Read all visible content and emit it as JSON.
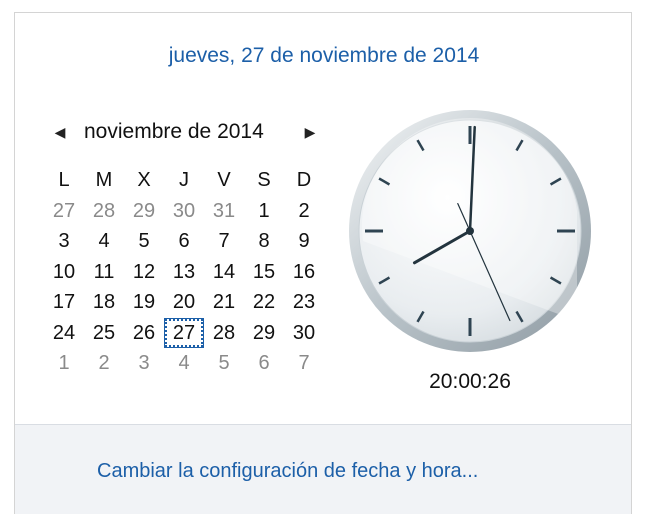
{
  "header": {
    "date_long": "jueves, 27 de noviembre de 2014"
  },
  "calendar": {
    "prev_arrow": "◀",
    "next_arrow": "▶",
    "month_label": "noviembre de 2014",
    "weekdays": [
      "L",
      "M",
      "X",
      "J",
      "V",
      "S",
      "D"
    ],
    "weeks": [
      [
        {
          "d": "27",
          "o": true
        },
        {
          "d": "28",
          "o": true
        },
        {
          "d": "29",
          "o": true
        },
        {
          "d": "30",
          "o": true
        },
        {
          "d": "31",
          "o": true
        },
        {
          "d": "1"
        },
        {
          "d": "2"
        }
      ],
      [
        {
          "d": "3"
        },
        {
          "d": "4"
        },
        {
          "d": "5"
        },
        {
          "d": "6"
        },
        {
          "d": "7"
        },
        {
          "d": "8"
        },
        {
          "d": "9"
        }
      ],
      [
        {
          "d": "10"
        },
        {
          "d": "11"
        },
        {
          "d": "12"
        },
        {
          "d": "13"
        },
        {
          "d": "14"
        },
        {
          "d": "15"
        },
        {
          "d": "16"
        }
      ],
      [
        {
          "d": "17"
        },
        {
          "d": "18"
        },
        {
          "d": "19"
        },
        {
          "d": "20"
        },
        {
          "d": "21"
        },
        {
          "d": "22"
        },
        {
          "d": "23"
        }
      ],
      [
        {
          "d": "24"
        },
        {
          "d": "25"
        },
        {
          "d": "26"
        },
        {
          "d": "27",
          "today": true
        },
        {
          "d": "28"
        },
        {
          "d": "29"
        },
        {
          "d": "30"
        }
      ],
      [
        {
          "d": "1",
          "o": true
        },
        {
          "d": "2",
          "o": true
        },
        {
          "d": "3",
          "o": true
        },
        {
          "d": "4",
          "o": true
        },
        {
          "d": "5",
          "o": true
        },
        {
          "d": "6",
          "o": true
        },
        {
          "d": "7",
          "o": true
        }
      ]
    ]
  },
  "clock": {
    "time_text": "20:00:26",
    "hours": 20,
    "minutes": 0,
    "seconds": 26,
    "face_color": "#e9edf0",
    "rim_color": "#b8c2c8",
    "hand_color": "#23343e",
    "tick_color": "#2f4452"
  },
  "footer": {
    "link_label": "Cambiar la configuración de fecha y hora..."
  },
  "colors": {
    "accent": "#1c5fa8"
  }
}
